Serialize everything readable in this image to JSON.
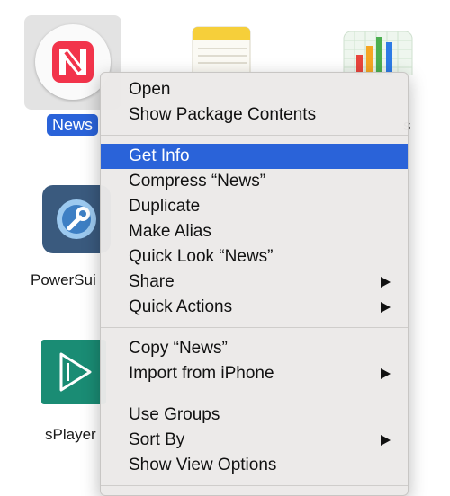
{
  "desktop": {
    "icons": [
      {
        "name": "news",
        "label": "News",
        "icon": "news-icon",
        "selected": true
      },
      {
        "name": "notes",
        "label": "",
        "icon": "notes-icon"
      },
      {
        "name": "numbers",
        "label": "s",
        "icon": "numbers-chart-icon"
      },
      {
        "name": "powersuite",
        "label": "PowerSui",
        "icon": "wrench-icon"
      },
      {
        "name": "splayer",
        "label": "sPlayer",
        "icon": "play-icon"
      }
    ]
  },
  "menu": {
    "groups": [
      [
        {
          "label": "Open"
        },
        {
          "label": "Show Package Contents"
        }
      ],
      [
        {
          "label": "Get Info",
          "highlighted": true
        },
        {
          "label": "Compress “News”"
        },
        {
          "label": "Duplicate"
        },
        {
          "label": "Make Alias"
        },
        {
          "label": "Quick Look “News”"
        },
        {
          "label": "Share",
          "submenu": true
        },
        {
          "label": "Quick Actions",
          "submenu": true
        }
      ],
      [
        {
          "label": "Copy “News”"
        },
        {
          "label": "Import from iPhone",
          "submenu": true
        }
      ],
      [
        {
          "label": "Use Groups"
        },
        {
          "label": "Sort By",
          "submenu": true
        },
        {
          "label": "Show View Options"
        }
      ]
    ]
  },
  "colors": {
    "selection": "#2a63d9",
    "news_red": "#f2344b",
    "splayer_green": "#1a8c74",
    "powersuite_blue": "#3d7fc4"
  }
}
